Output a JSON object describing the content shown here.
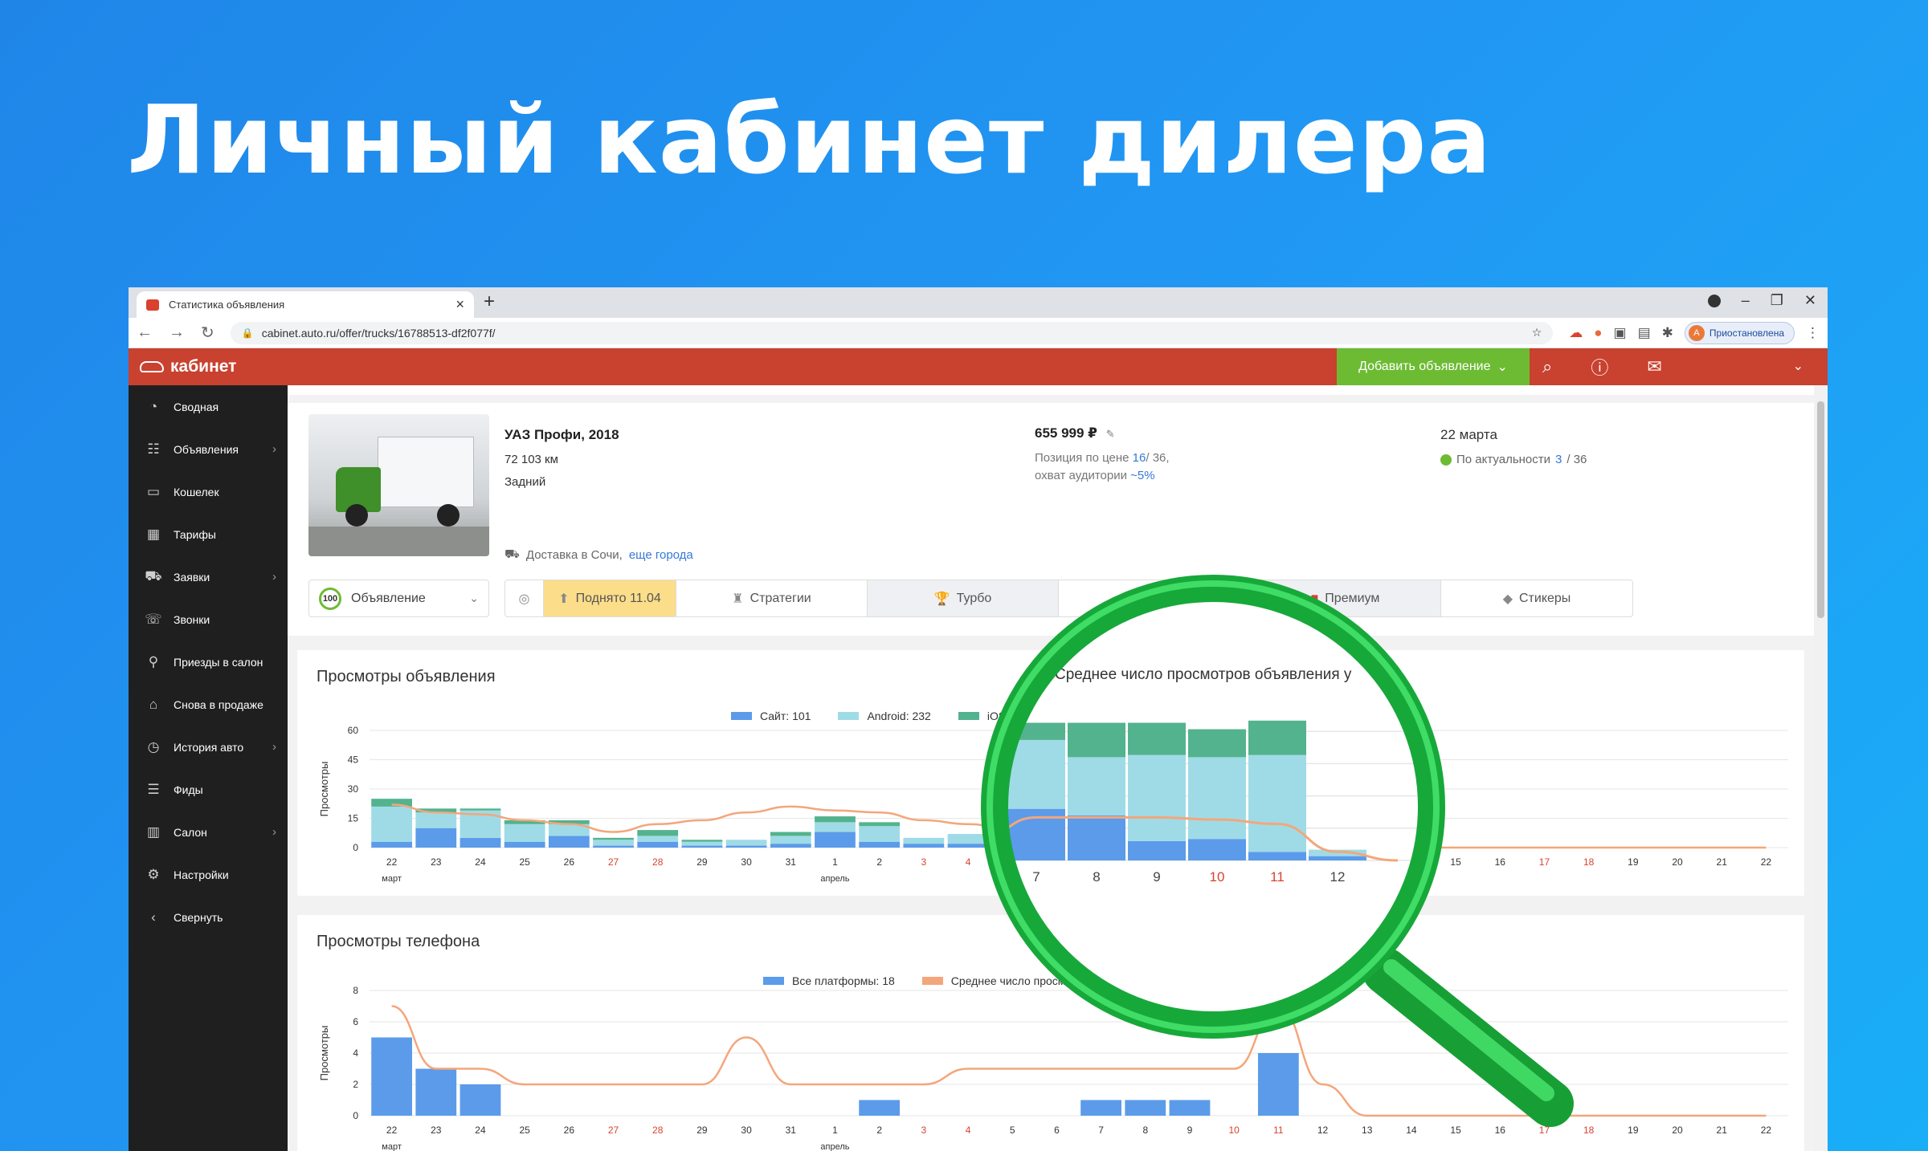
{
  "hero": {
    "title": "Личный кабинет дилера"
  },
  "browser": {
    "tab_title": "Статистика объявления",
    "url": "cabinet.auto.ru/offer/trucks/16788513-df2f077f/",
    "profile_status": "Приостановлена",
    "profile_initial": "A"
  },
  "app": {
    "logo_text": "кабинет",
    "add_button": "Добавить объявление"
  },
  "sidebar": {
    "items": [
      {
        "label": "Сводная",
        "icon": "dashboard-icon",
        "glyph": "◔",
        "chevron": false
      },
      {
        "label": "Объявления",
        "icon": "listings-icon",
        "glyph": "☷",
        "chevron": true
      },
      {
        "label": "Кошелек",
        "icon": "wallet-icon",
        "glyph": "▭",
        "chevron": false
      },
      {
        "label": "Тарифы",
        "icon": "tariffs-icon",
        "glyph": "▦",
        "chevron": false
      },
      {
        "label": "Заявки",
        "icon": "requests-icon",
        "glyph": "⛟",
        "chevron": true
      },
      {
        "label": "Звонки",
        "icon": "calls-icon",
        "glyph": "☏",
        "chevron": false
      },
      {
        "label": "Приезды в салон",
        "icon": "visits-icon",
        "glyph": "⚲",
        "chevron": false
      },
      {
        "label": "Снова в продаже",
        "icon": "tag-icon",
        "glyph": "⌂",
        "chevron": false
      },
      {
        "label": "История авто",
        "icon": "history-icon",
        "glyph": "◷",
        "chevron": true
      },
      {
        "label": "Фиды",
        "icon": "feeds-icon",
        "glyph": "☰",
        "chevron": false
      },
      {
        "label": "Салон",
        "icon": "salon-icon",
        "glyph": "▥",
        "chevron": true
      },
      {
        "label": "Настройки",
        "icon": "settings-icon",
        "glyph": "⚙",
        "chevron": false
      },
      {
        "label": "Свернуть",
        "icon": "collapse-icon",
        "glyph": "‹",
        "chevron": false
      }
    ]
  },
  "offer": {
    "title": "УАЗ Профи, 2018",
    "mileage": "72 103 км",
    "drive": "Задний",
    "delivery_prefix": "Доставка в Сочи,",
    "delivery_link": "еще города",
    "price": "655 999 ₽",
    "position_prefix": "Позиция по цене",
    "position_value": "16",
    "position_total": "/ 36,",
    "reach_prefix": "охват аудитории",
    "reach_value": "~5%",
    "date": "22 марта",
    "actuality_prefix": "По актуальности",
    "actuality_value": "3",
    "actuality_total": "/ 36"
  },
  "controls": {
    "select_badge": "100",
    "select_label": "Объявление",
    "services": [
      {
        "label": "",
        "icon": "gear-badge-icon",
        "glyph": "◎",
        "active": false
      },
      {
        "label": "Поднято 11.04",
        "icon": "raise-icon",
        "glyph": "⬆",
        "active": true
      },
      {
        "label": "Стратегии",
        "icon": "strategy-icon",
        "glyph": "♜",
        "active": false
      },
      {
        "label": "Турбо",
        "icon": "trophy-icon",
        "glyph": "🏆",
        "active": false
      },
      {
        "label": "",
        "icon": "hidden-service-icon",
        "glyph": "",
        "active": false
      },
      {
        "label": "Премиум",
        "icon": "premium-icon",
        "glyph": "■",
        "active": false
      },
      {
        "label": "Стикеры",
        "icon": "sticker-icon",
        "glyph": "◆",
        "active": false
      }
    ]
  },
  "chart_data": [
    {
      "type": "bar",
      "title": "Просмотры объявления",
      "ylabel": "Просмотры",
      "ylim": [
        0,
        60
      ],
      "yticks": [
        0,
        15,
        30,
        45,
        60
      ],
      "categories": [
        "22",
        "23",
        "24",
        "25",
        "26",
        "27",
        "28",
        "29",
        "30",
        "31",
        "1",
        "2",
        "3",
        "4",
        "5",
        "6",
        "7",
        "8",
        "9",
        "10",
        "11",
        "12",
        "13",
        "14",
        "15",
        "16",
        "17",
        "18",
        "19",
        "20",
        "21",
        "22"
      ],
      "weekend": [
        5,
        6,
        12,
        13,
        19,
        20,
        26,
        27
      ],
      "month_labels": [
        {
          "index": 0,
          "text": "март"
        },
        {
          "index": 10,
          "text": "апрель"
        }
      ],
      "series": [
        {
          "name": "Сайт: 101",
          "color": "#5b9bea",
          "values": [
            3,
            10,
            5,
            3,
            6,
            1,
            3,
            1,
            1,
            2,
            8,
            3,
            2,
            2,
            2,
            2,
            24,
            21,
            9,
            10,
            4,
            2,
            0,
            0,
            0,
            0,
            0,
            0,
            0,
            0,
            0,
            0
          ]
        },
        {
          "name": "Android: 232",
          "color": "#9fdbe6",
          "values": [
            18,
            8,
            14,
            9,
            6,
            3,
            3,
            2,
            3,
            4,
            5,
            8,
            3,
            5,
            7,
            5,
            32,
            27,
            40,
            38,
            45,
            3,
            0,
            0,
            0,
            0,
            0,
            0,
            0,
            0,
            0,
            0
          ]
        },
        {
          "name": "iOS",
          "color": "#53b38e",
          "values": [
            4,
            2,
            1,
            2,
            2,
            1,
            3,
            1,
            0,
            2,
            3,
            2,
            0,
            0,
            1,
            1,
            8,
            16,
            15,
            13,
            16,
            0,
            0,
            0,
            0,
            0,
            0,
            0,
            0,
            0,
            0,
            0
          ]
        }
      ],
      "average_line": {
        "color": "#f4a67b",
        "values": [
          22,
          18,
          17,
          14,
          12,
          8,
          12,
          14,
          18,
          21,
          19,
          18,
          14,
          12,
          9,
          9,
          20,
          20,
          20,
          19,
          17,
          4,
          0,
          0,
          0,
          0,
          0,
          0,
          0,
          0,
          0,
          0
        ]
      }
    },
    {
      "type": "bar",
      "title": "Просмотры телефона",
      "ylabel": "Просмотры",
      "ylim": [
        0,
        8
      ],
      "yticks": [
        0,
        2,
        4,
        6,
        8
      ],
      "categories": [
        "22",
        "23",
        "24",
        "25",
        "26",
        "27",
        "28",
        "29",
        "30",
        "31",
        "1",
        "2",
        "3",
        "4",
        "5",
        "6",
        "7",
        "8",
        "9",
        "10",
        "11",
        "12",
        "13",
        "14",
        "15",
        "16",
        "17",
        "18",
        "19",
        "20",
        "21",
        "22"
      ],
      "weekend": [
        5,
        6,
        12,
        13,
        19,
        20,
        26,
        27
      ],
      "month_labels": [
        {
          "index": 0,
          "text": "март"
        },
        {
          "index": 10,
          "text": "апрель"
        }
      ],
      "series": [
        {
          "name": "Все платформы: 18",
          "color": "#5b9bea",
          "values": [
            5,
            3,
            2,
            0,
            0,
            0,
            0,
            0,
            0,
            0,
            0,
            1,
            0,
            0,
            0,
            0,
            1,
            1,
            1,
            0,
            4,
            0,
            0,
            0,
            0,
            0,
            0,
            0,
            0,
            0,
            0,
            0
          ]
        }
      ],
      "average_line": {
        "name": "Среднее число просмотров",
        "color": "#f4a67b",
        "values": [
          7,
          3,
          3,
          2,
          2,
          2,
          2,
          2,
          5,
          2,
          2,
          2,
          2,
          3,
          3,
          3,
          3,
          3,
          3,
          3,
          7,
          2,
          0,
          0,
          0,
          0,
          0,
          0,
          0,
          0,
          0,
          0
        ]
      }
    }
  ],
  "magnifier": {
    "title": "Среднее число просмотров объявления у"
  },
  "colors": {
    "brand_red": "#c9412f",
    "add_green": "#6dbb33",
    "link_blue": "#3579d6",
    "weekend_red": "#d9422f",
    "magnifier_green": "#1ec24a"
  }
}
